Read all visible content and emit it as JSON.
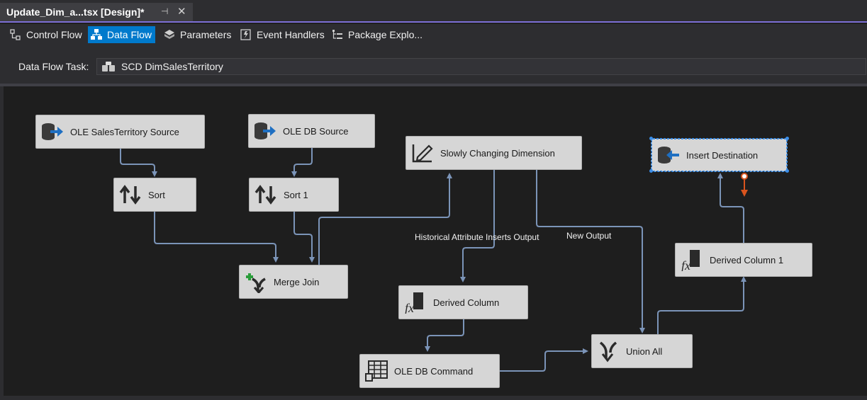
{
  "document_tab": {
    "title": "Update_Dim_a...tsx [Design]*",
    "pin_glyph": "⊣",
    "close_glyph": "✕"
  },
  "designer_tabs": [
    {
      "label": "Control Flow",
      "icon": "control-flow-icon",
      "active": false
    },
    {
      "label": "Data Flow",
      "icon": "data-flow-icon",
      "active": true
    },
    {
      "label": "Parameters",
      "icon": "parameters-icon",
      "active": false
    },
    {
      "label": "Event Handlers",
      "icon": "event-handlers-icon",
      "active": false
    },
    {
      "label": "Package Explo...",
      "icon": "package-explorer-icon",
      "active": false
    }
  ],
  "task_bar": {
    "label": "Data Flow Task:",
    "selected": "SCD DimSalesTerritory"
  },
  "components": {
    "ole_salesterritory_source": {
      "label": "OLE SalesTerritory Source",
      "icon": "ole-source-icon"
    },
    "ole_db_source": {
      "label": "OLE DB Source",
      "icon": "ole-source-icon"
    },
    "sort": {
      "label": "Sort",
      "icon": "sort-icon"
    },
    "sort_1": {
      "label": "Sort 1",
      "icon": "sort-icon"
    },
    "merge_join": {
      "label": "Merge Join",
      "icon": "merge-join-icon"
    },
    "slowly_changing_dimension": {
      "label": "Slowly Changing Dimension",
      "icon": "scd-icon"
    },
    "derived_column": {
      "label": "Derived Column",
      "icon": "derived-column-icon"
    },
    "ole_db_command": {
      "label": "OLE DB Command",
      "icon": "ole-db-command-icon"
    },
    "union_all": {
      "label": "Union All",
      "icon": "union-all-icon"
    },
    "derived_column_1": {
      "label": "Derived Column 1",
      "icon": "derived-column-icon"
    },
    "insert_destination": {
      "label": "Insert Destination",
      "icon": "ole-destination-icon",
      "selected": true
    }
  },
  "path_labels": {
    "historical": "Historical Attribute Inserts Output",
    "new_output": "New Output"
  },
  "colors": {
    "accent": "#007acc",
    "tab_underline": "#7c6fd6",
    "path_line": "#7b94b8",
    "error_path": "#d9541e",
    "selection": "#3b8ee8"
  }
}
